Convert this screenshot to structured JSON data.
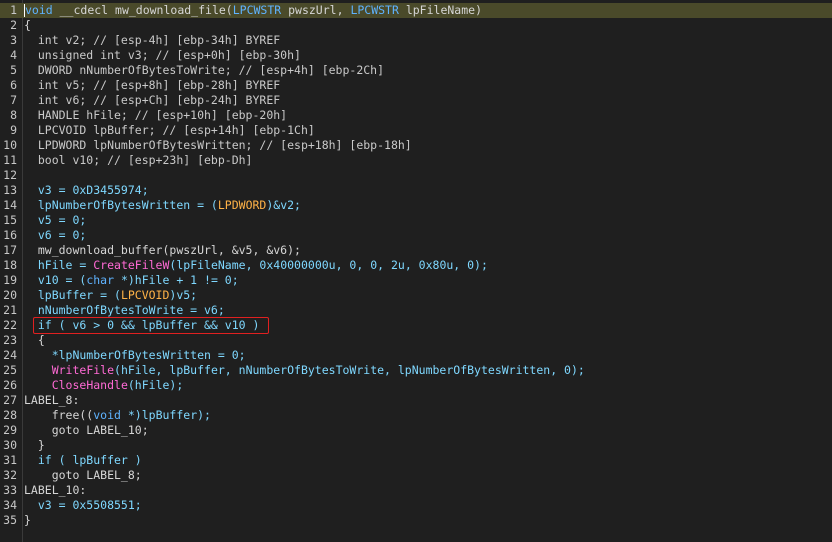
{
  "editor": {
    "colors": {
      "background": "#1f1f1f",
      "keyword": "#5fb3ff",
      "identifier": "#7fd8ff",
      "function": "#ff6ad5",
      "cast": "#ffb347",
      "highlight_border": "#e02020",
      "current_line": "#4a4a2a"
    },
    "lines": [
      {
        "n": "1",
        "segs": [
          {
            "t": "void",
            "c": "kw"
          },
          {
            "t": " __cdecl mw_download_file(",
            "c": "pl"
          },
          {
            "t": "LPCWSTR",
            "c": "ty"
          },
          {
            "t": " pwszUrl, ",
            "c": "pl"
          },
          {
            "t": "LPCWSTR",
            "c": "ty"
          },
          {
            "t": " lpFileName)",
            "c": "pl"
          }
        ]
      },
      {
        "n": "2",
        "segs": [
          {
            "t": "{",
            "c": "pl"
          }
        ]
      },
      {
        "n": "3",
        "segs": [
          {
            "t": "  int v2; // [esp-4h] [ebp-34h] BYREF",
            "c": "cm"
          }
        ]
      },
      {
        "n": "4",
        "segs": [
          {
            "t": "  unsigned int v3; // [esp+0h] [ebp-30h]",
            "c": "cm"
          }
        ]
      },
      {
        "n": "5",
        "segs": [
          {
            "t": "  DWORD nNumberOfBytesToWrite; // [esp+4h] [ebp-2Ch]",
            "c": "cm"
          }
        ]
      },
      {
        "n": "6",
        "segs": [
          {
            "t": "  int v5; // [esp+8h] [ebp-28h] BYREF",
            "c": "cm"
          }
        ]
      },
      {
        "n": "7",
        "segs": [
          {
            "t": "  int v6; // [esp+Ch] [ebp-24h] BYREF",
            "c": "cm"
          }
        ]
      },
      {
        "n": "8",
        "segs": [
          {
            "t": "  HANDLE hFile; // [esp+10h] [ebp-20h]",
            "c": "cm"
          }
        ]
      },
      {
        "n": "9",
        "segs": [
          {
            "t": "  LPCVOID lpBuffer; // [esp+14h] [ebp-1Ch]",
            "c": "cm"
          }
        ]
      },
      {
        "n": "10",
        "segs": [
          {
            "t": "  LPDWORD lpNumberOfBytesWritten; // [esp+18h] [ebp-18h]",
            "c": "cm"
          }
        ]
      },
      {
        "n": "11",
        "segs": [
          {
            "t": "  bool v10; // [esp+23h] [ebp-Dh]",
            "c": "cm"
          }
        ]
      },
      {
        "n": "12",
        "segs": []
      },
      {
        "n": "13",
        "segs": [
          {
            "t": "  v3 = 0xD3455974;",
            "c": "id"
          }
        ]
      },
      {
        "n": "14",
        "segs": [
          {
            "t": "  lpNumberOfBytesWritten = (",
            "c": "id"
          },
          {
            "t": "LPDWORD",
            "c": "cast"
          },
          {
            "t": ")&v2;",
            "c": "id"
          }
        ]
      },
      {
        "n": "15",
        "segs": [
          {
            "t": "  v5 = 0;",
            "c": "id"
          }
        ]
      },
      {
        "n": "16",
        "segs": [
          {
            "t": "  v6 = 0;",
            "c": "id"
          }
        ]
      },
      {
        "n": "17",
        "segs": [
          {
            "t": "  mw_download_buffer(pwszUrl, &v5, &v6);",
            "c": "pl"
          }
        ]
      },
      {
        "n": "18",
        "segs": [
          {
            "t": "  hFile = ",
            "c": "id"
          },
          {
            "t": "CreateFileW",
            "c": "fn"
          },
          {
            "t": "(lpFileName, 0x40000000u, 0, 0, 2u, 0x80u, 0);",
            "c": "id"
          }
        ]
      },
      {
        "n": "19",
        "segs": [
          {
            "t": "  v10 = (",
            "c": "id"
          },
          {
            "t": "char",
            "c": "kw"
          },
          {
            "t": " *)hFile + 1 != 0;",
            "c": "id"
          }
        ]
      },
      {
        "n": "20",
        "segs": [
          {
            "t": "  lpBuffer = (",
            "c": "id"
          },
          {
            "t": "LPCVOID",
            "c": "cast"
          },
          {
            "t": ")v5;",
            "c": "id"
          }
        ]
      },
      {
        "n": "21",
        "segs": [
          {
            "t": "  nNumberOfBytesToWrite = v6;",
            "c": "id"
          }
        ]
      },
      {
        "n": "22",
        "segs": [
          {
            "t": "  if ( v6 > 0 && lpBuffer && v10 )",
            "c": "id"
          }
        ]
      },
      {
        "n": "23",
        "segs": [
          {
            "t": "  {",
            "c": "pl"
          }
        ]
      },
      {
        "n": "24",
        "segs": [
          {
            "t": "    *lpNumberOfBytesWritten = 0;",
            "c": "id"
          }
        ]
      },
      {
        "n": "25",
        "segs": [
          {
            "t": "    ",
            "c": "pl"
          },
          {
            "t": "WriteFile",
            "c": "fn"
          },
          {
            "t": "(hFile, lpBuffer, nNumberOfBytesToWrite, lpNumberOfBytesWritten, 0);",
            "c": "id"
          }
        ]
      },
      {
        "n": "26",
        "segs": [
          {
            "t": "    ",
            "c": "pl"
          },
          {
            "t": "CloseHandle",
            "c": "fn"
          },
          {
            "t": "(hFile);",
            "c": "id"
          }
        ]
      },
      {
        "n": "27",
        "segs": [
          {
            "t": "LABEL_8:",
            "c": "pl"
          }
        ]
      },
      {
        "n": "28",
        "segs": [
          {
            "t": "    free((",
            "c": "pl"
          },
          {
            "t": "void",
            "c": "kw"
          },
          {
            "t": " *)lpBuffer);",
            "c": "id"
          }
        ]
      },
      {
        "n": "29",
        "segs": [
          {
            "t": "    goto LABEL_10;",
            "c": "pl"
          }
        ]
      },
      {
        "n": "30",
        "segs": [
          {
            "t": "  }",
            "c": "pl"
          }
        ]
      },
      {
        "n": "31",
        "segs": [
          {
            "t": "  if ( lpBuffer )",
            "c": "id"
          }
        ]
      },
      {
        "n": "32",
        "segs": [
          {
            "t": "    goto LABEL_8;",
            "c": "pl"
          }
        ]
      },
      {
        "n": "33",
        "segs": [
          {
            "t": "LABEL_10:",
            "c": "pl"
          }
        ]
      },
      {
        "n": "34",
        "segs": [
          {
            "t": "  v3 = 0x5508551;",
            "c": "id"
          }
        ]
      },
      {
        "n": "35",
        "segs": [
          {
            "t": "}",
            "c": "pl"
          }
        ]
      }
    ]
  }
}
